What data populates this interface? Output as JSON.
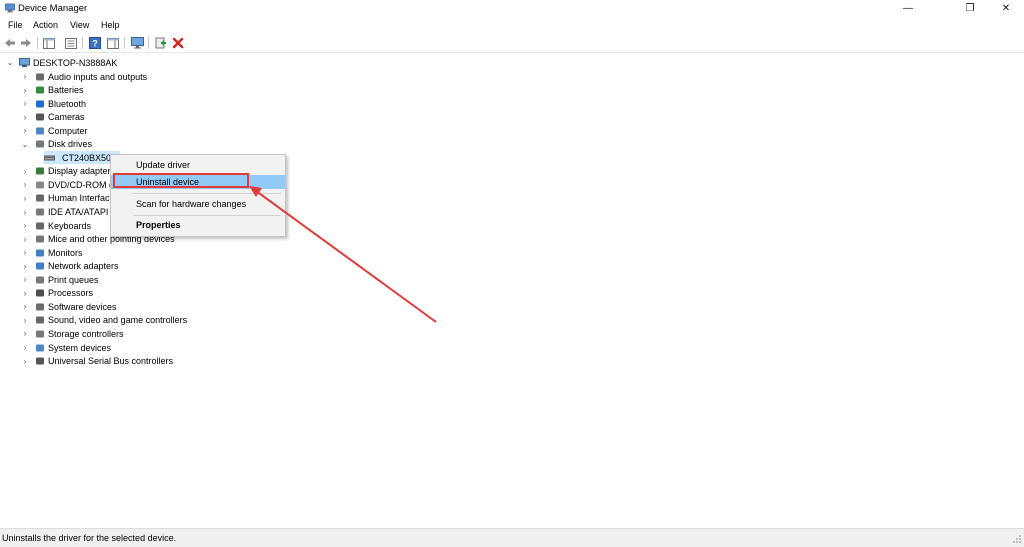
{
  "window": {
    "title": "Device Manager",
    "controls": {
      "minimize": "—",
      "maximize": "❐",
      "close": "✕"
    }
  },
  "menu": [
    "File",
    "Action",
    "View",
    "Help"
  ],
  "toolbar": {
    "icons": [
      "back-icon",
      "forward-icon",
      "show-hide-console-tree-icon",
      "properties-icon",
      "help-icon",
      "action-pane-icon",
      "monitor-icon",
      "update-driver-icon",
      "uninstall-device-icon"
    ]
  },
  "tree": {
    "root": "DESKTOP-N3888AK",
    "categories": [
      {
        "label": "Audio inputs and outputs",
        "icon": "speaker-icon"
      },
      {
        "label": "Batteries",
        "icon": "battery-icon"
      },
      {
        "label": "Bluetooth",
        "icon": "bluetooth-icon"
      },
      {
        "label": "Cameras",
        "icon": "camera-icon"
      },
      {
        "label": "Computer",
        "icon": "computer-icon"
      },
      {
        "label": "Disk drives",
        "icon": "disk-drive-icon",
        "expanded": true
      },
      {
        "label": "Display adapter",
        "icon": "display-adapter-icon"
      },
      {
        "label": "DVD/CD-ROM d",
        "icon": "dvd-icon"
      },
      {
        "label": "Human Interfac",
        "icon": "hid-icon"
      },
      {
        "label": "IDE ATA/ATAPI c",
        "icon": "ide-icon"
      },
      {
        "label": "Keyboards",
        "icon": "keyboard-icon"
      },
      {
        "label": "Mice and other pointing devices",
        "icon": "mouse-icon"
      },
      {
        "label": "Monitors",
        "icon": "monitor-icon"
      },
      {
        "label": "Network adapters",
        "icon": "network-icon"
      },
      {
        "label": "Print queues",
        "icon": "printer-icon"
      },
      {
        "label": "Processors",
        "icon": "processor-icon"
      },
      {
        "label": "Software devices",
        "icon": "software-device-icon"
      },
      {
        "label": "Sound, video and game controllers",
        "icon": "sound-icon"
      },
      {
        "label": "Storage controllers",
        "icon": "storage-icon"
      },
      {
        "label": "System devices",
        "icon": "system-icon"
      },
      {
        "label": "Universal Serial Bus controllers",
        "icon": "usb-icon"
      }
    ],
    "disk_child": "CT240BX500"
  },
  "context_menu": {
    "items": [
      "Update driver",
      "Uninstall device",
      "Scan for hardware changes",
      "Properties"
    ],
    "highlighted": "Uninstall device"
  },
  "status": {
    "text": "Uninstalls the driver for the selected device."
  },
  "colors": {
    "highlight": "#91c9f7",
    "annotation": "#e03a3a",
    "selection": "#cce8ff"
  }
}
